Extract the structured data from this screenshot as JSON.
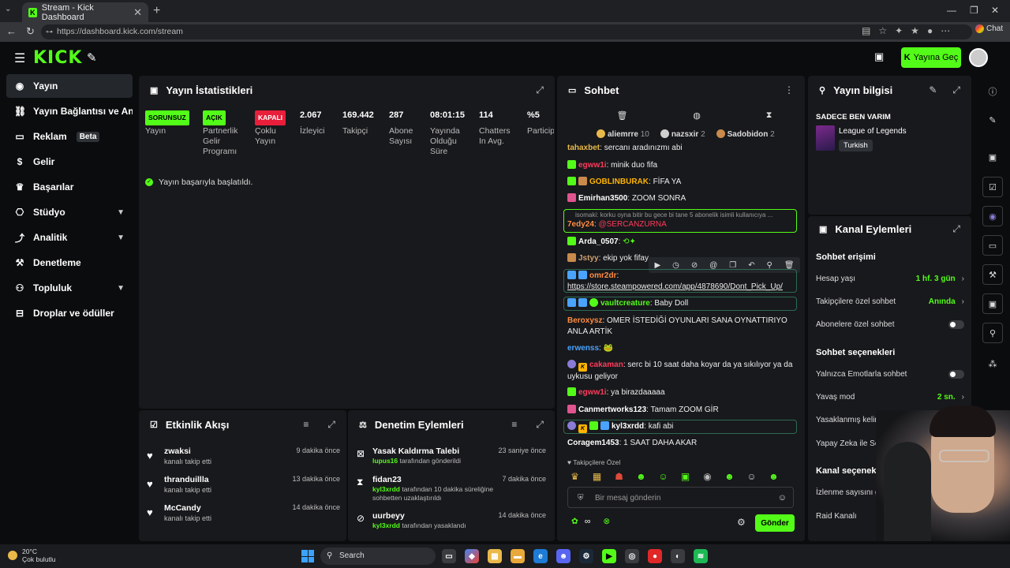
{
  "browser": {
    "tab_title": "Stream - Kick Dashboard",
    "url": "https://dashboard.kick.com/stream",
    "chat_label": "Chat"
  },
  "header": {
    "logo": "KICK",
    "go_live": "Yayına Geç"
  },
  "sidebar": {
    "items": [
      {
        "label": "Yayın",
        "icon": "broadcast-icon"
      },
      {
        "label": "Yayın Bağlantısı ve Anahtar",
        "icon": "link-icon"
      },
      {
        "label": "Reklam",
        "icon": "ad-icon",
        "badge": "Beta"
      },
      {
        "label": "Gelir",
        "icon": "dollar-icon"
      },
      {
        "label": "Başarılar",
        "icon": "trophy-icon"
      },
      {
        "label": "Stüdyo",
        "icon": "studio-icon"
      },
      {
        "label": "Analitik",
        "icon": "chart-icon"
      },
      {
        "label": "Denetleme",
        "icon": "hammer-icon"
      },
      {
        "label": "Topluluk",
        "icon": "users-icon"
      },
      {
        "label": "Droplar ve ödüller",
        "icon": "gift-icon"
      }
    ]
  },
  "stats": {
    "title": "Yayın İstatistikleri",
    "columns": [
      {
        "value": "SORUNSUZ",
        "label": "Yayın",
        "type": "pill-green"
      },
      {
        "value": "AÇIK",
        "label": "Partnerlik Gelir Programı",
        "type": "pill-green"
      },
      {
        "value": "KAPALI",
        "label": "Çoklu Yayın",
        "type": "pill-red"
      },
      {
        "value": "2.067",
        "label": "İzleyici",
        "type": "number"
      },
      {
        "value": "169.442",
        "label": "Takipçi",
        "type": "number"
      },
      {
        "value": "287",
        "label": "Abone Sayısı",
        "type": "number"
      },
      {
        "value": "08:01:15",
        "label": "Yayında Olduğu Süre",
        "type": "number"
      },
      {
        "value": "114",
        "label": "Chatters In Avg.",
        "type": "number"
      },
      {
        "value": "%5",
        "label": "Particip",
        "type": "number"
      }
    ],
    "success": "Yayın başarıyla başlatıldı."
  },
  "activity": {
    "title": "Etkinlik Akışı",
    "items": [
      {
        "name": "zwaksi",
        "sub": "kanalı takip etti",
        "time": "9 dakika önce"
      },
      {
        "name": "thranduillla",
        "sub": "kanalı takip etti",
        "time": "13 dakika önce"
      },
      {
        "name": "McCandy",
        "sub": "kanalı takip etti",
        "time": "14 dakika önce"
      }
    ]
  },
  "moderation": {
    "title": "Denetim Eylemleri",
    "items": [
      {
        "name": "Yasak Kaldırma Talebi",
        "actor": "lupus16",
        "sub": "tarafından gönderildi",
        "time": "23 saniye önce",
        "icon": "unban-request-icon"
      },
      {
        "name": "fidan23",
        "actor": "kyl3xrdd",
        "sub": "tarafından 10 dakika süreliğine sohbetten uzaklaştırıldı",
        "time": "7 dakika önce",
        "icon": "hourglass-icon"
      },
      {
        "name": "uurbeyy",
        "actor": "kyl3xrdd",
        "sub": "tarafından yasaklandı",
        "time": "14 dakika önce",
        "icon": "ban-icon"
      }
    ]
  },
  "chat": {
    "title": "Sohbet",
    "pinned": [
      {
        "name": "aliemrre",
        "count": "10",
        "color": "#e9b949"
      },
      {
        "name": "nazsxir",
        "count": "2",
        "color": "#cfcfcf"
      },
      {
        "name": "Sadobidon",
        "count": "2",
        "color": "#c98a4b"
      }
    ],
    "messages": [
      {
        "user": "tahaxbet",
        "color": "#e9b949",
        "text": "sercanı aradınızmı abi"
      },
      {
        "user": "egww1i",
        "color": "#ff3b5c",
        "text": "minik duo fifa"
      },
      {
        "user": "GOBLINBURAK",
        "color": "#ffb400",
        "text": "FİFA YA"
      },
      {
        "user": "Emirhan3500",
        "color": "#ffffff",
        "text": "ZOOM SONRA"
      },
      {
        "user": "",
        "color": "#999999",
        "text": "isomaki: korku oyna bitir bu gece bi tane 5 abonelik isimli kullanıcıya ..."
      },
      {
        "user": "7edy24",
        "color": "#ff8c42",
        "text": "@SERCANZURNA"
      },
      {
        "user": "Arda_0507",
        "color": "#ffffff",
        "text": ""
      },
      {
        "user": "Jstyy",
        "color": "#cfa070",
        "text": "ekip yok fifay"
      },
      {
        "user": "omr2dr",
        "color": "#ff8c42",
        "text": ""
      },
      {
        "user": "",
        "color": "#ffffff",
        "text": "https://store.steampowered.com/app/4878690/Dont_Pick_Up/"
      },
      {
        "user": "vaultcreature",
        "color": "#53fc18",
        "text": "Baby Doll"
      },
      {
        "user": "Beroxysz",
        "color": "#ff8c42",
        "text": "OMER İSTEDİĞİ OYUNLARI SANA OYNATTIRIYO ANLA ARTİK"
      },
      {
        "user": "erwenss",
        "color": "#4aa3ff",
        "text": ""
      },
      {
        "user": "cakaman",
        "color": "#ff3b5c",
        "text": "serc bi 10 saat daha koyar da ya sıkılıyor ya da uykusu geliyor"
      },
      {
        "user": "egww1i",
        "color": "#ff3b5c",
        "text": "ya birazdaaaaa"
      },
      {
        "user": "Canmertworks123",
        "color": "#ffffff",
        "text": "Tamam ZOOM GİR"
      },
      {
        "user": "kyl3xrdd",
        "color": "#ffffff",
        "text": "kafi abi"
      },
      {
        "user": "Coragem1453",
        "color": "#ffffff",
        "text": "1 SAAT DAHA AKAR"
      }
    ],
    "followers_only": "Takipçilere Özel",
    "input_placeholder": "Bir mesaj gönderin",
    "send": "Gönder",
    "infinity": "∞"
  },
  "stream_info": {
    "title": "Yayın bilgisi",
    "stream_title": "SADECE BEN VARIM",
    "category": "League of Legends",
    "language": "Turkish"
  },
  "channel_actions": {
    "title": "Kanal Eylemleri",
    "chat_access": "Sohbet erişimi",
    "account_age_label": "Hesap yaşı",
    "account_age_value": "1 hf. 3 gün",
    "followers_chat_label": "Takipçilere özel sohbet",
    "followers_chat_value": "Anında",
    "subs_chat_label": "Abonelere özel sohbet",
    "chat_options": "Sohbet seçenekleri",
    "emote_only_label": "Yalnızca Emotlarla sohbet",
    "slow_mode_label": "Yavaş mod",
    "slow_mode_value": "2 sn.",
    "banned_words": "Yasaklanmış kelimeler",
    "ai_moderation": "Yapay Zeka ile Sohbet Denetimi",
    "channel_options": "Kanal seçenekleri",
    "show_viewcount": "İzlenme sayısını göster",
    "raid": "Raid Kanalı"
  },
  "taskbar": {
    "temp": "20°C",
    "weather": "Çok bulutlu",
    "search": "Search"
  }
}
